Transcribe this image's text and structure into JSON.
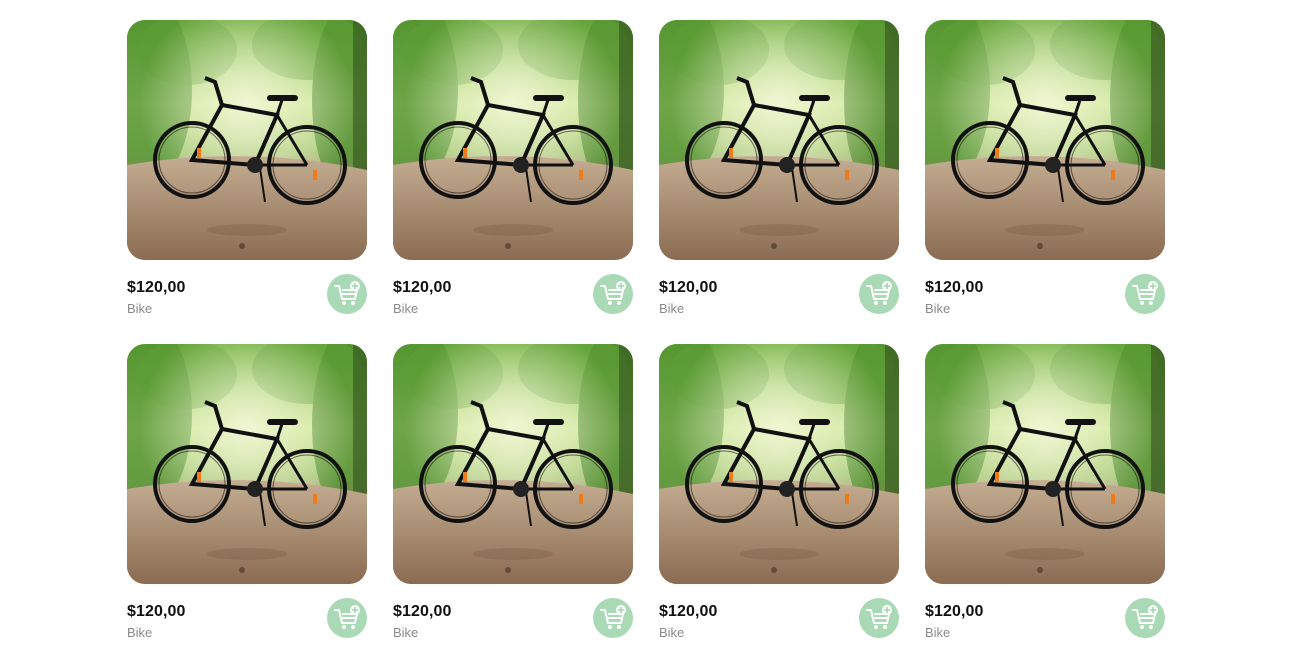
{
  "products": [
    {
      "price": "$120,00",
      "name": "Bike",
      "image": "bike-in-forest-photo",
      "action_icon": "add-to-cart-icon"
    },
    {
      "price": "$120,00",
      "name": "Bike",
      "image": "bike-in-forest-photo",
      "action_icon": "add-to-cart-icon"
    },
    {
      "price": "$120,00",
      "name": "Bike",
      "image": "bike-in-forest-photo",
      "action_icon": "add-to-cart-icon"
    },
    {
      "price": "$120,00",
      "name": "Bike",
      "image": "bike-in-forest-photo",
      "action_icon": "add-to-cart-icon"
    },
    {
      "price": "$120,00",
      "name": "Bike",
      "image": "bike-in-forest-photo",
      "action_icon": "add-to-cart-icon"
    },
    {
      "price": "$120,00",
      "name": "Bike",
      "image": "bike-in-forest-photo",
      "action_icon": "add-to-cart-icon"
    },
    {
      "price": "$120,00",
      "name": "Bike",
      "image": "bike-in-forest-photo",
      "action_icon": "add-to-cart-icon"
    },
    {
      "price": "$120,00",
      "name": "Bike",
      "image": "bike-in-forest-photo",
      "action_icon": "add-to-cart-icon"
    }
  ],
  "colors": {
    "cart_button": "#a9d9b5",
    "price_text": "#111111",
    "name_text": "#8a8a8a"
  }
}
